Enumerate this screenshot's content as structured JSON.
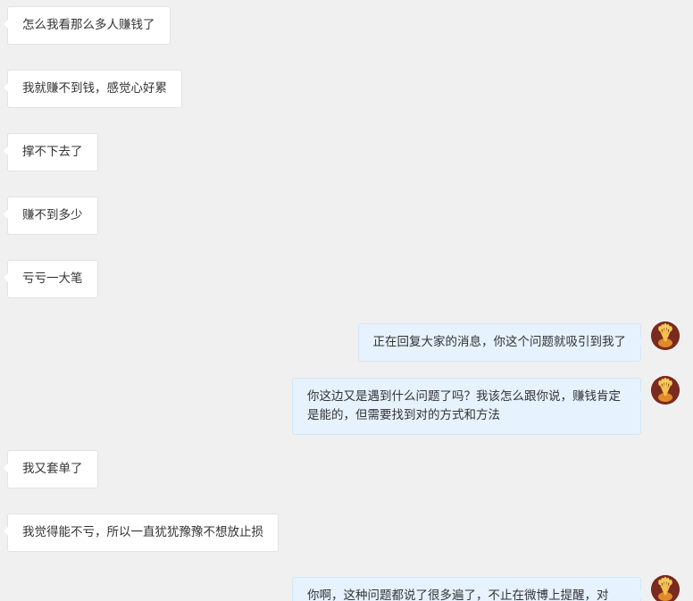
{
  "chat": {
    "messages": [
      {
        "side": "in",
        "text": "怎么我看那么多人赚钱了"
      },
      {
        "side": "in",
        "text": "我就赚不到钱，感觉心好累"
      },
      {
        "side": "in",
        "text": "撑不下去了"
      },
      {
        "side": "in",
        "text": "赚不到多少"
      },
      {
        "side": "in",
        "text": "亏亏一大笔"
      },
      {
        "side": "out",
        "text": "正在回复大家的消息，你这个问题就吸引到我了"
      },
      {
        "side": "out",
        "text": "你这边又是遇到什么问题了吗？我该怎么跟你说，赚钱肯定是能的，但需要找到对的方式和方法"
      },
      {
        "side": "in",
        "text": "我又套单了"
      },
      {
        "side": "in",
        "text": "我觉得能不亏，所以一直犹犹豫豫不想放止损"
      },
      {
        "side": "out",
        "text": "你啊，这种问题都说了很多遍了，不止在微博上提醒，对"
      }
    ],
    "colors": {
      "background": "#f0f0f0",
      "incoming_bubble": "#ffffff",
      "outgoing_bubble": "#e6f2fd",
      "avatar_bg": "#7a2a1f"
    },
    "avatar_icon": "wheat-sheaf-avatar"
  }
}
